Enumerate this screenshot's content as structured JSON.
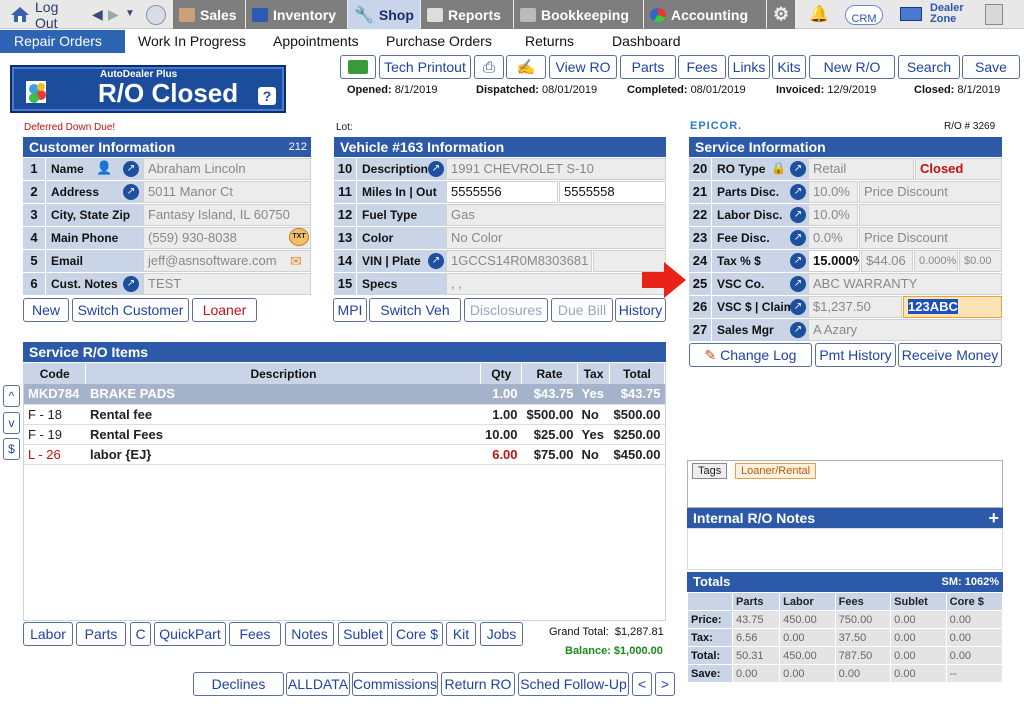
{
  "topbar": {
    "logout": "Log Out",
    "sales": "Sales",
    "inventory": "Inventory",
    "shop": "Shop",
    "reports": "Reports",
    "bookkeeping": "Bookkeeping",
    "accounting": "Accounting",
    "crm": "CRM",
    "dealer_zone_1": "Dealer",
    "dealer_zone_2": "Zone"
  },
  "subnav": [
    "Repair Orders",
    "Work In Progress",
    "Appointments",
    "Purchase Orders",
    "Returns",
    "Dashboard"
  ],
  "banner": {
    "small": "AutoDealer Plus",
    "title": "R/O Closed",
    "help": "?"
  },
  "toolbar": [
    "Tech Printout",
    "View RO",
    "Parts",
    "Fees",
    "Links",
    "Kits",
    "New R/O",
    "Search",
    "Save"
  ],
  "dates": {
    "opened_label": "Opened:",
    "opened": "8/1/2019",
    "dispatched_label": "Dispatched:",
    "dispatched": "08/01/2019",
    "completed_label": "Completed:",
    "completed": "08/01/2019",
    "invoiced_label": "Invoiced:",
    "invoiced": "12/9/2019",
    "closed_label": "Closed:",
    "closed": "8/1/2019"
  },
  "deferred": "Deferred Down Due!",
  "lot_label": "Lot:",
  "epicor": "EPICOR.",
  "ro_number": "R/O # 3269",
  "customer": {
    "title": "Customer Information",
    "id": "212",
    "rows": [
      {
        "n": "1",
        "label": "Name",
        "value": "Abraham Lincoln"
      },
      {
        "n": "2",
        "label": "Address",
        "value": "5011 Manor Ct"
      },
      {
        "n": "3",
        "label": "City, State Zip",
        "value": "Fantasy Island, IL 60750"
      },
      {
        "n": "4",
        "label": "Main Phone",
        "value": "(559) 930-8038"
      },
      {
        "n": "5",
        "label": "Email",
        "value": "jeff@asnsoftware.com"
      },
      {
        "n": "6",
        "label": "Cust. Notes",
        "value": "TEST"
      }
    ],
    "txt": "TXT",
    "buttons": [
      "New",
      "Switch Customer",
      "Loaner"
    ]
  },
  "vehicle": {
    "title": "Vehicle #163 Information",
    "rows": [
      {
        "n": "10",
        "label": "Description",
        "value": "1991 CHEVROLET S-10"
      },
      {
        "n": "11",
        "label": "Miles  In | Out",
        "value": "5555556",
        "value2": "5555558"
      },
      {
        "n": "12",
        "label": "Fuel Type",
        "value": "Gas"
      },
      {
        "n": "13",
        "label": "Color",
        "value": "No Color"
      },
      {
        "n": "14",
        "label": "VIN | Plate",
        "value": "1GCCS14R0M8303681"
      },
      {
        "n": "15",
        "label": "Specs",
        "value": ", ,"
      }
    ],
    "buttons": [
      "MPI",
      "Switch Veh",
      "Disclosures",
      "Due Bill",
      "History"
    ]
  },
  "service": {
    "title": "Service Information",
    "rows": [
      {
        "n": "20",
        "label": "RO Type",
        "value": "Retail",
        "value2": "Closed"
      },
      {
        "n": "21",
        "label": "Parts Disc.",
        "value": "10.0%",
        "value2": "Price Discount"
      },
      {
        "n": "22",
        "label": "Labor Disc.",
        "value": "10.0%",
        "value2": ""
      },
      {
        "n": "23",
        "label": "Fee Disc.",
        "value": "0.0%",
        "value2": "Price Discount"
      },
      {
        "n": "24",
        "label": "Tax % $",
        "value": "15.000%",
        "value2": "$44.06",
        "value3": "0.000%",
        "value4": "$0.00"
      },
      {
        "n": "25",
        "label": "VSC  Co.",
        "value": "ABC WARRANTY"
      },
      {
        "n": "26",
        "label": "VSC $ | Claim #",
        "value": "$1,237.50",
        "value2": "123ABC"
      },
      {
        "n": "27",
        "label": "Sales Mgr",
        "value": "A Azary"
      }
    ],
    "buttons": [
      "Change Log",
      "Pmt History",
      "Receive Money"
    ]
  },
  "items": {
    "title": "Service R/O Items",
    "headers": [
      "Code",
      "Description",
      "Qty",
      "Rate",
      "Tax",
      "Total"
    ],
    "rows": [
      {
        "code": "MKD784",
        "desc": "BRAKE PADS",
        "qty": "1.00",
        "rate": "$43.75",
        "tax": "Yes",
        "total": "$43.75"
      },
      {
        "code": "F - 18",
        "desc": "Rental fee",
        "qty": "1.00",
        "rate": "$500.00",
        "tax": "No",
        "total": "$500.00"
      },
      {
        "code": "F - 19",
        "desc": "Rental Fees",
        "qty": "10.00",
        "rate": "$25.00",
        "tax": "Yes",
        "total": "$250.00"
      },
      {
        "code": "L - 26",
        "desc": "labor {EJ}",
        "qty": "6.00",
        "rate": "$75.00",
        "tax": "No",
        "total": "$450.00"
      }
    ],
    "side_buttons": [
      "^",
      "v",
      "$"
    ]
  },
  "bottom_buttons": [
    "Labor",
    "Parts",
    "C",
    "QuickPart",
    "Fees",
    "Notes",
    "Sublet",
    "Core $",
    "Kit",
    "Jobs"
  ],
  "grand_total_label": "Grand Total:",
  "grand_total": "$1,287.81",
  "balance_label": "Balance:",
  "balance": "$1,000.00",
  "footer_buttons": [
    "Declines",
    "ALLDATA",
    "Commissions",
    "Return RO",
    "Sched Follow-Up",
    "<",
    ">"
  ],
  "tags": {
    "tags_label": "Tags",
    "loaner_label": "Loaner/Rental"
  },
  "notes": {
    "title": "Internal R/O Notes",
    "add": "+"
  },
  "totals": {
    "title": "Totals",
    "sm": "SM: 1062%",
    "headers": [
      "",
      "Parts",
      "Labor",
      "Fees",
      "Sublet",
      "Core $"
    ],
    "rows": [
      [
        "Price:",
        "43.75",
        "450.00",
        "750.00",
        "0.00",
        "0.00"
      ],
      [
        "Tax:",
        "6.56",
        "0.00",
        "37.50",
        "0.00",
        "0.00"
      ],
      [
        "Total:",
        "50.31",
        "450.00",
        "787.50",
        "0.00",
        "0.00"
      ],
      [
        "Save:",
        "0.00",
        "0.00",
        "0.00",
        "0.00",
        "--"
      ]
    ]
  },
  "colors": {
    "accent": "#2d5aa8",
    "header_bg": "#c9d4e6",
    "closed_red": "#c01010",
    "arrow_red": "#e8231a",
    "balance_green": "#1a8a1a"
  }
}
